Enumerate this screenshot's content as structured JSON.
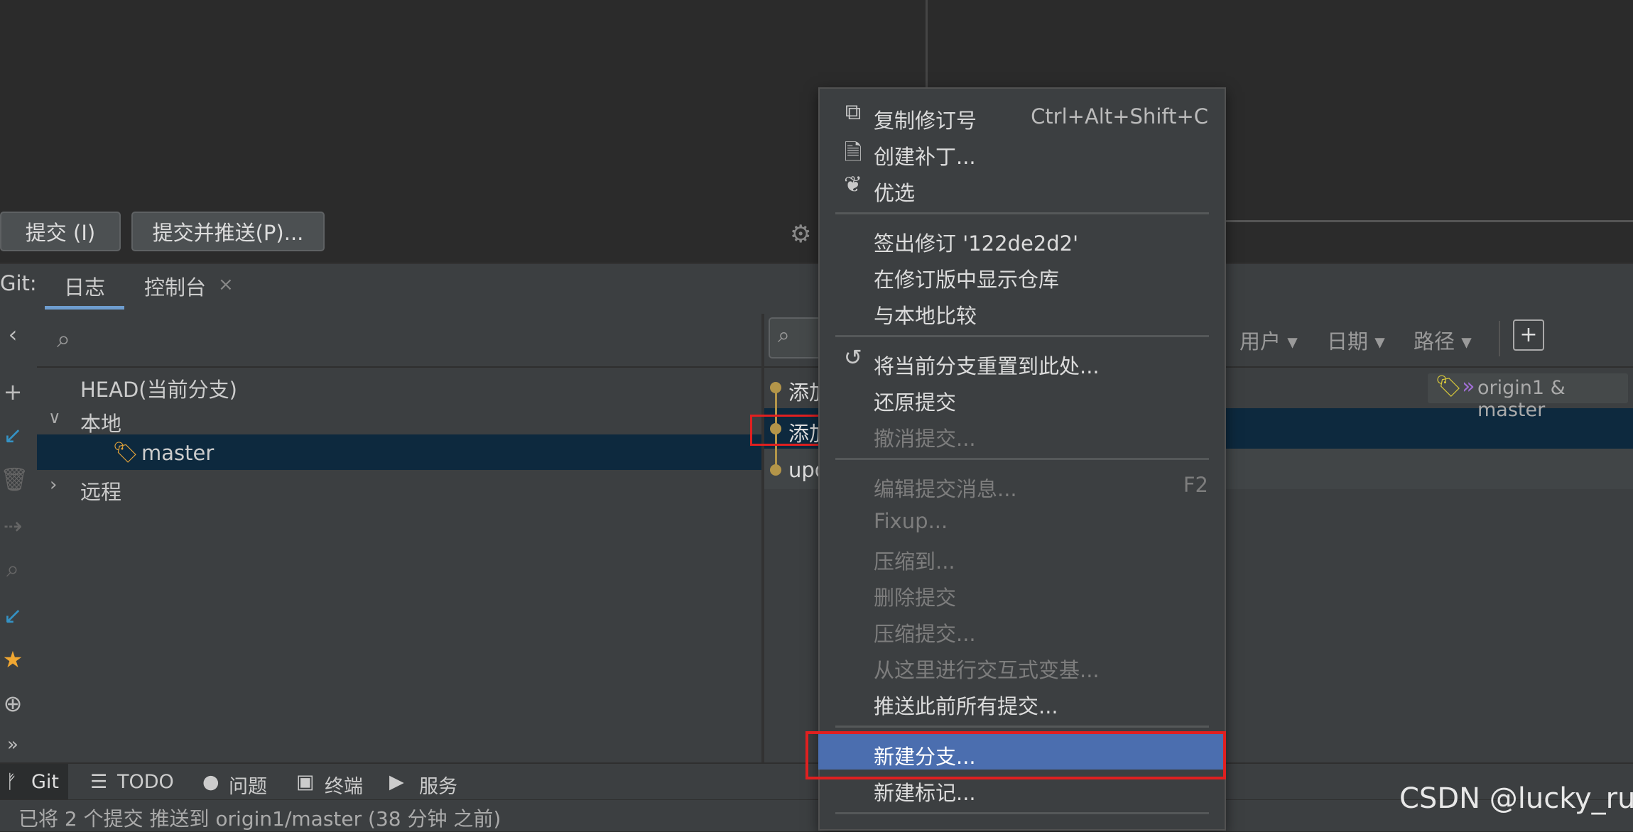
{
  "commit_buttons": {
    "commit_label": "提交 (I)",
    "commit_push_label": "提交并推送(P)..."
  },
  "git_tabs": {
    "prefix": "Git:",
    "log_label": "日志",
    "console_label": "控制台",
    "close_glyph": "×"
  },
  "branches": {
    "head": "HEAD(当前分支)",
    "local": "本地",
    "master": "master",
    "remote": "远程"
  },
  "log": {
    "filters": {
      "user": "用户 ▾",
      "date": "日期 ▾",
      "path": "路径 ▾"
    },
    "commits": [
      "添加",
      "添加",
      "upd"
    ],
    "ref_badge": "origin1 & master"
  },
  "context_menu": {
    "items": [
      {
        "label": "复制修订号",
        "shortcut": "Ctrl+Alt+Shift+C",
        "icon": "copy-icon"
      },
      {
        "label": "创建补丁...",
        "icon": "patch-icon"
      },
      {
        "label": "优选",
        "icon": "cherry-pick-icon"
      },
      {
        "label": "签出修订 '122de2d2'"
      },
      {
        "label": "在修订版中显示仓库"
      },
      {
        "label": "与本地比较"
      },
      {
        "label": "将当前分支重置到此处...",
        "icon": "reset-icon"
      },
      {
        "label": "还原提交"
      },
      {
        "label": "撤消提交..."
      },
      {
        "label": "编辑提交消息...",
        "shortcut": "F2"
      },
      {
        "label": "Fixup..."
      },
      {
        "label": "压缩到..."
      },
      {
        "label": "删除提交"
      },
      {
        "label": "压缩提交..."
      },
      {
        "label": "从这里进行交互式变基..."
      },
      {
        "label": "推送此前所有提交..."
      },
      {
        "label": "新建分支..."
      },
      {
        "label": "新建标记..."
      }
    ]
  },
  "bottom_tabs": {
    "git": "Git",
    "todo": "TODO",
    "problems": "问题",
    "terminal": "终端",
    "services": "服务"
  },
  "status_text": "已将 2 个提交 推送到 origin1/master (38 分钟 之前)",
  "watermark": "CSDN @lucky_ru",
  "colors": {
    "background": "#2b2b2b",
    "panel": "#3c3f41",
    "selection": "#0d293e",
    "menu_highlight": "#4b6eaf",
    "annotation_red": "#e02020",
    "graph": "#b39549"
  }
}
